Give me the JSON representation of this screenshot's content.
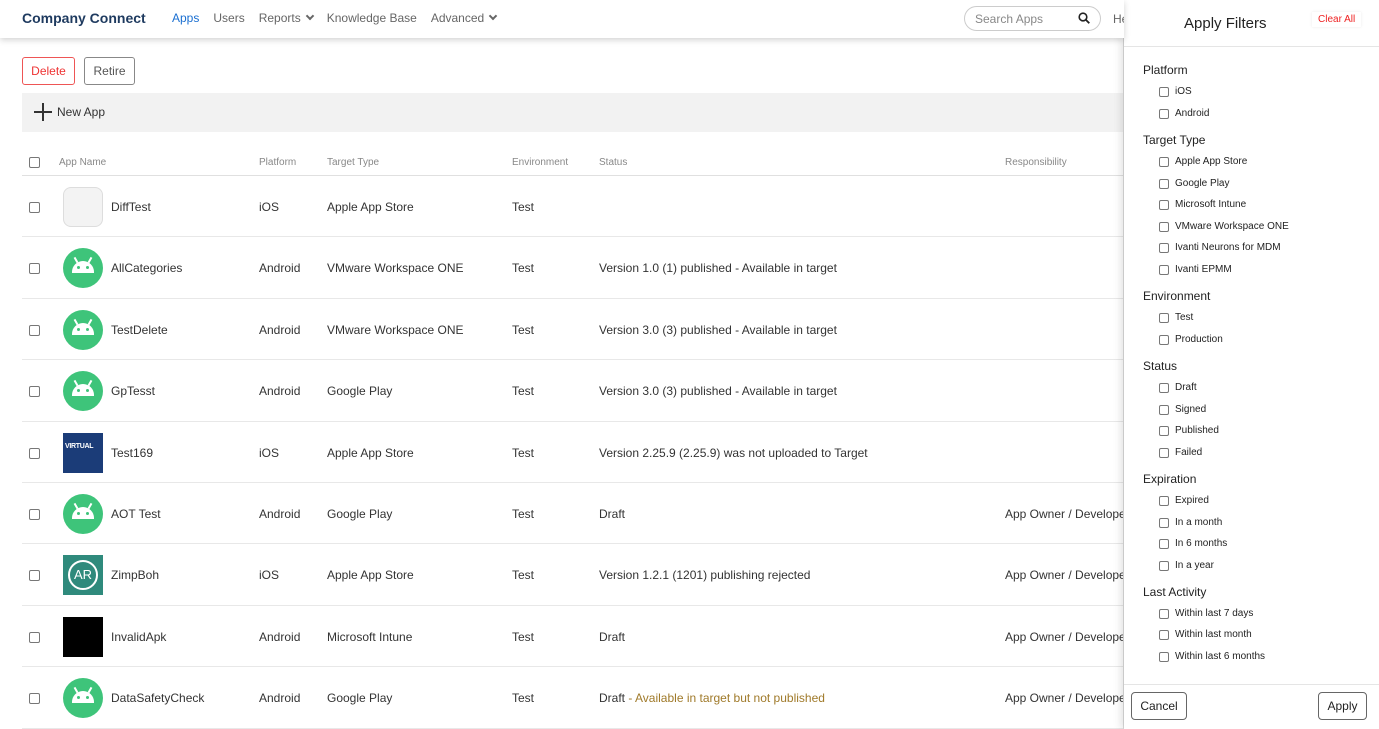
{
  "header": {
    "brand": "Company Connect",
    "nav": [
      {
        "label": "Apps",
        "active": true
      },
      {
        "label": "Users",
        "active": false
      },
      {
        "label": "Reports",
        "active": false
      },
      {
        "label": "Knowledge Base",
        "active": false
      },
      {
        "label": "Advanced",
        "active": false
      }
    ],
    "search_placeholder": "Search Apps",
    "help_partial": "He"
  },
  "actions": {
    "delete": "Delete",
    "retire": "Retire",
    "new_app": "New App"
  },
  "table": {
    "columns": [
      "App Name",
      "Platform",
      "Target Type",
      "Environment",
      "Status",
      "Responsibility"
    ],
    "rows": [
      {
        "name": "DiffTest",
        "platform": "iOS",
        "target": "Apple App Store",
        "env": "Test",
        "status": "",
        "status_warn": "",
        "resp": "",
        "icon": "diff-placeholder-icon"
      },
      {
        "name": "AllCategories",
        "platform": "Android",
        "target": "VMware Workspace ONE",
        "env": "Test",
        "status": "Version 1.0 (1) published - Available in target",
        "status_warn": "",
        "resp": "",
        "icon": "android-icon"
      },
      {
        "name": "TestDelete",
        "platform": "Android",
        "target": "VMware Workspace ONE",
        "env": "Test",
        "status": "Version 3.0 (3) published - Available in target",
        "status_warn": "",
        "resp": "",
        "icon": "android-icon"
      },
      {
        "name": "GpTesst",
        "platform": "Android",
        "target": "Google Play",
        "env": "Test",
        "status": "Version 3.0 (3) published - Available in target",
        "status_warn": "",
        "resp": "",
        "icon": "android-icon"
      },
      {
        "name": "Test169",
        "platform": "iOS",
        "target": "Apple App Store",
        "env": "Test",
        "status": "Version 2.25.9 (2.25.9) was not uploaded to Target",
        "status_warn": "",
        "resp": "",
        "icon": "virtual-logo-icon"
      },
      {
        "name": "AOT Test",
        "platform": "Android",
        "target": "Google Play",
        "env": "Test",
        "status": "Draft",
        "status_warn": "",
        "resp": "App Owner / Developer",
        "icon": "android-icon"
      },
      {
        "name": "ZimpBoh",
        "platform": "iOS",
        "target": "Apple App Store",
        "env": "Test",
        "status": "Version 1.2.1 (1201) publishing rejected",
        "status_warn": "",
        "resp": "App Owner / Developer",
        "icon": "ar-logo-icon"
      },
      {
        "name": "InvalidApk",
        "platform": "Android",
        "target": "Microsoft Intune",
        "env": "Test",
        "status": "Draft",
        "status_warn": "",
        "resp": "App Owner / Developer",
        "icon": "black-square-icon"
      },
      {
        "name": "DataSafetyCheck",
        "platform": "Android",
        "target": "Google Play",
        "env": "Test",
        "status": "Draft",
        "status_warn": " - Available in target but not published",
        "resp": "App Owner / Developer",
        "icon": "android-icon"
      }
    ]
  },
  "filters": {
    "title": "Apply Filters",
    "clear_all": "Clear All",
    "groups": [
      {
        "title": "Platform",
        "options": [
          "iOS",
          "Android"
        ]
      },
      {
        "title": "Target Type",
        "options": [
          "Apple App Store",
          "Google Play",
          "Microsoft Intune",
          "VMware Workspace ONE",
          "Ivanti Neurons for MDM",
          "Ivanti EPMM"
        ]
      },
      {
        "title": "Environment",
        "options": [
          "Test",
          "Production"
        ]
      },
      {
        "title": "Status",
        "options": [
          "Draft",
          "Signed",
          "Published",
          "Failed"
        ]
      },
      {
        "title": "Expiration",
        "options": [
          "Expired",
          "In a month",
          "In 6 months",
          "In a year"
        ]
      },
      {
        "title": "Last Activity",
        "options": [
          "Within last 7 days",
          "Within last month",
          "Within last 6 months"
        ]
      }
    ],
    "cancel": "Cancel",
    "apply": "Apply"
  },
  "colors": {
    "brand": "#1e3a5f",
    "nav_active": "#1a6fd1",
    "danger": "#e33333",
    "android_green": "#3ec47a",
    "warning_text": "#a07a2a"
  }
}
